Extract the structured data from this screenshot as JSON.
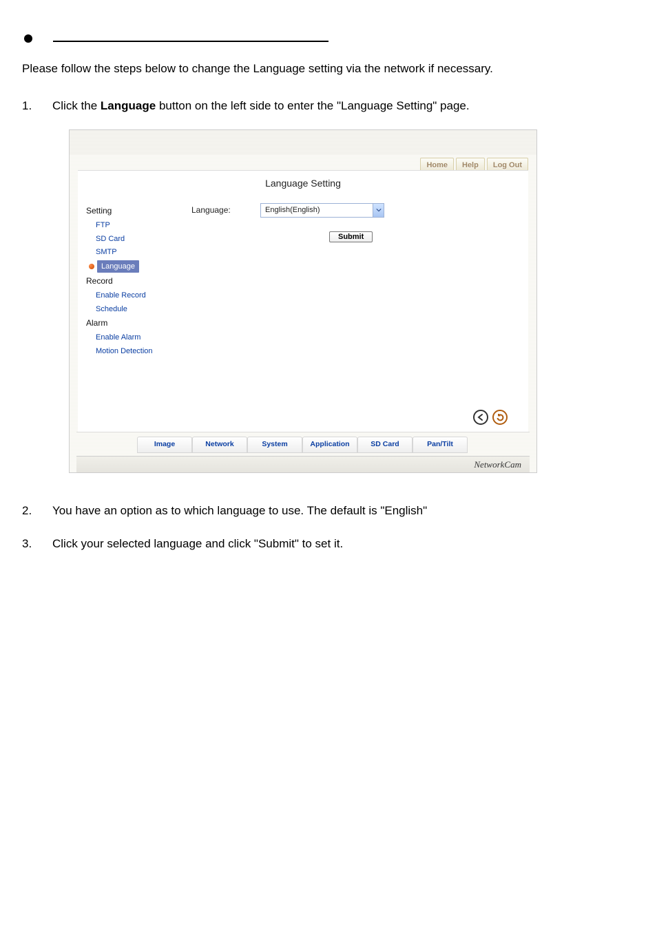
{
  "doc": {
    "intro": "Please follow the steps below to change the Language setting via the network if necessary.",
    "step1_pre": "Click the ",
    "step1_bold": "Language",
    "step1_post": " button on the left side to enter the \"Language Setting\" page.",
    "step2": "You have an option as to which language to use. The default is \"English\"",
    "step3": "Click your selected language and click \"Submit\" to set it.",
    "num1": "1.",
    "num2": "2.",
    "num3": "3."
  },
  "topnav": {
    "home": "Home",
    "help": "Help",
    "logout": "Log Out"
  },
  "panel": {
    "title": "Language Setting",
    "form_label": "Language:",
    "select_value": "English(English)",
    "submit": "Submit"
  },
  "sidebar": {
    "setting": "Setting",
    "ftp": "FTP",
    "sdcard": "SD Card",
    "smtp": "SMTP",
    "language": "Language",
    "record": "Record",
    "enable_record": "Enable Record",
    "schedule": "Schedule",
    "alarm": "Alarm",
    "enable_alarm": "Enable Alarm",
    "motion": "Motion Detection"
  },
  "tabs": {
    "image": "Image",
    "network": "Network",
    "system": "System",
    "application": "Application",
    "sdcard": "SD Card",
    "pantilt": "Pan/Tilt"
  },
  "footer": "NetworkCam"
}
